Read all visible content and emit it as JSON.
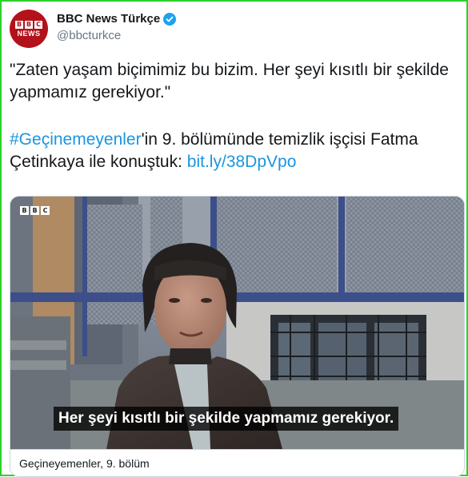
{
  "author": {
    "display_name": "BBC News Türkçe",
    "handle": "@bbcturkce",
    "avatar_logo_letters": [
      "B",
      "B",
      "C"
    ],
    "avatar_word": "NEWS",
    "verified": true
  },
  "tweet": {
    "line1": "\"Zaten yaşam biçimimiz bu bizim. Her şeyi kısıtlı bir şekilde yapmamız gerekiyor.\"",
    "hashtag": "#Geçinemeyenler",
    "text_after_hashtag": "'in 9. bölümünde temizlik işçisi Fatma Çetinkaya ile konuştuk:  ",
    "link_text": "bit.ly/38DpVpo"
  },
  "card": {
    "watermark_letters": [
      "B",
      "B",
      "C"
    ],
    "subtitle": "Her şeyi kısıtlı bir şekilde yapmamız gerekiyor.",
    "title": "Geçineyemenler, 9. bölüm"
  },
  "colors": {
    "frame_border": "#2bd12b",
    "link": "#1b95e0",
    "bbc_red": "#b3121a",
    "verified": "#1da1f2"
  }
}
